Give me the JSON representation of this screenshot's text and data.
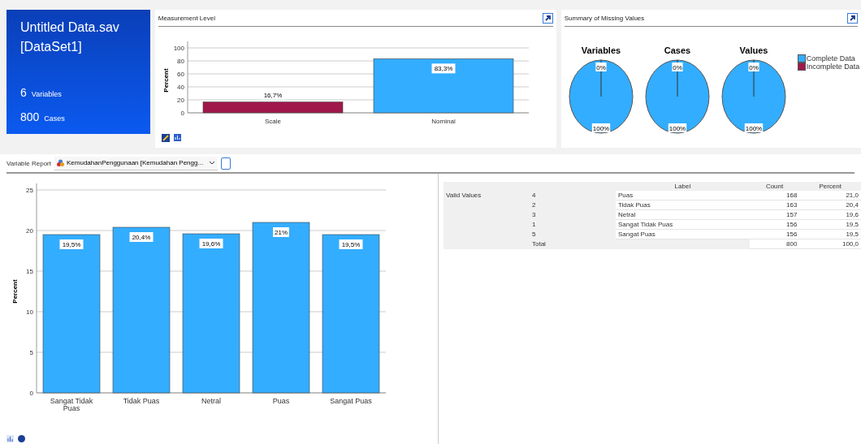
{
  "dataset_card": {
    "title": "Untitled Data.sav",
    "subtitle": "[DataSet1]",
    "stats": [
      {
        "value": "6",
        "label": "Variables"
      },
      {
        "value": "800",
        "label": "Cases"
      }
    ]
  },
  "measurement_panel": {
    "title": "Measurement Level",
    "chart_data": {
      "type": "bar",
      "ylabel": "Percent",
      "categories": [
        "Scale",
        "Nominal"
      ],
      "grid": true,
      "values": [
        16.7,
        83.3
      ],
      "colors": [
        "#a0174a",
        "#33adff"
      ],
      "ylim": [
        0,
        100
      ],
      "yticks": [
        0,
        20,
        40,
        60,
        80,
        100
      ],
      "value_labels": [
        "16,7%",
        "83,3%"
      ]
    }
  },
  "missing_panel": {
    "title": "Summary of Missing Values",
    "legend": [
      {
        "label": "Complete Data",
        "color": "#33adff"
      },
      {
        "label": "Incomplete Data",
        "color": "#a0174a"
      }
    ],
    "pies": [
      {
        "chart_data": {
          "type": "pie",
          "title": "Variables",
          "values": [
            0,
            100
          ],
          "colors": [
            "#a0174a",
            "#33adff"
          ],
          "value_labels": [
            "0%",
            "100%"
          ]
        }
      },
      {
        "chart_data": {
          "type": "pie",
          "title": "Cases",
          "values": [
            0,
            100
          ],
          "colors": [
            "#a0174a",
            "#33adff"
          ],
          "value_labels": [
            "0%",
            "100%"
          ]
        }
      },
      {
        "chart_data": {
          "type": "pie",
          "title": "Values",
          "values": [
            0,
            100
          ],
          "colors": [
            "#a0174a",
            "#33adff"
          ],
          "value_labels": [
            "0%",
            "100%"
          ]
        }
      }
    ]
  },
  "variable_report": {
    "label": "Variable Report",
    "selected_variable": "KemudahanPenggunaan  [Kemudahan Pengg...",
    "chart_data": {
      "type": "bar",
      "ylabel": "Percent",
      "categories": [
        "Sangat Tidak Puas",
        "Tidak Puas",
        "Netral",
        "Puas",
        "Sangat Puas"
      ],
      "grid": true,
      "values": [
        19.5,
        20.4,
        19.6,
        21,
        19.5
      ],
      "colors": [
        "#33adff",
        "#33adff",
        "#33adff",
        "#33adff",
        "#33adff"
      ],
      "ylim": [
        0,
        25
      ],
      "yticks": [
        0,
        5,
        10,
        15,
        20,
        25
      ],
      "value_labels": [
        "19,5%",
        "20,4%",
        "19,6%",
        "21%",
        "19,5%"
      ]
    },
    "table": {
      "columns": [
        "Label",
        "Count",
        "Percent"
      ],
      "group_label": "Valid Values",
      "rows": [
        {
          "value": "4",
          "label": "Puas",
          "count": "168",
          "percent": "21,0"
        },
        {
          "value": "2",
          "label": "Tidak Puas",
          "count": "163",
          "percent": "20,4"
        },
        {
          "value": "3",
          "label": "Netral",
          "count": "157",
          "percent": "19,6"
        },
        {
          "value": "1",
          "label": "Sangat Tidak Puas",
          "count": "156",
          "percent": "19,5"
        },
        {
          "value": "5",
          "label": "Sangat Puas",
          "count": "156",
          "percent": "19,5"
        },
        {
          "value": "Total",
          "label": "",
          "count": "800",
          "percent": "100,0"
        }
      ]
    }
  }
}
